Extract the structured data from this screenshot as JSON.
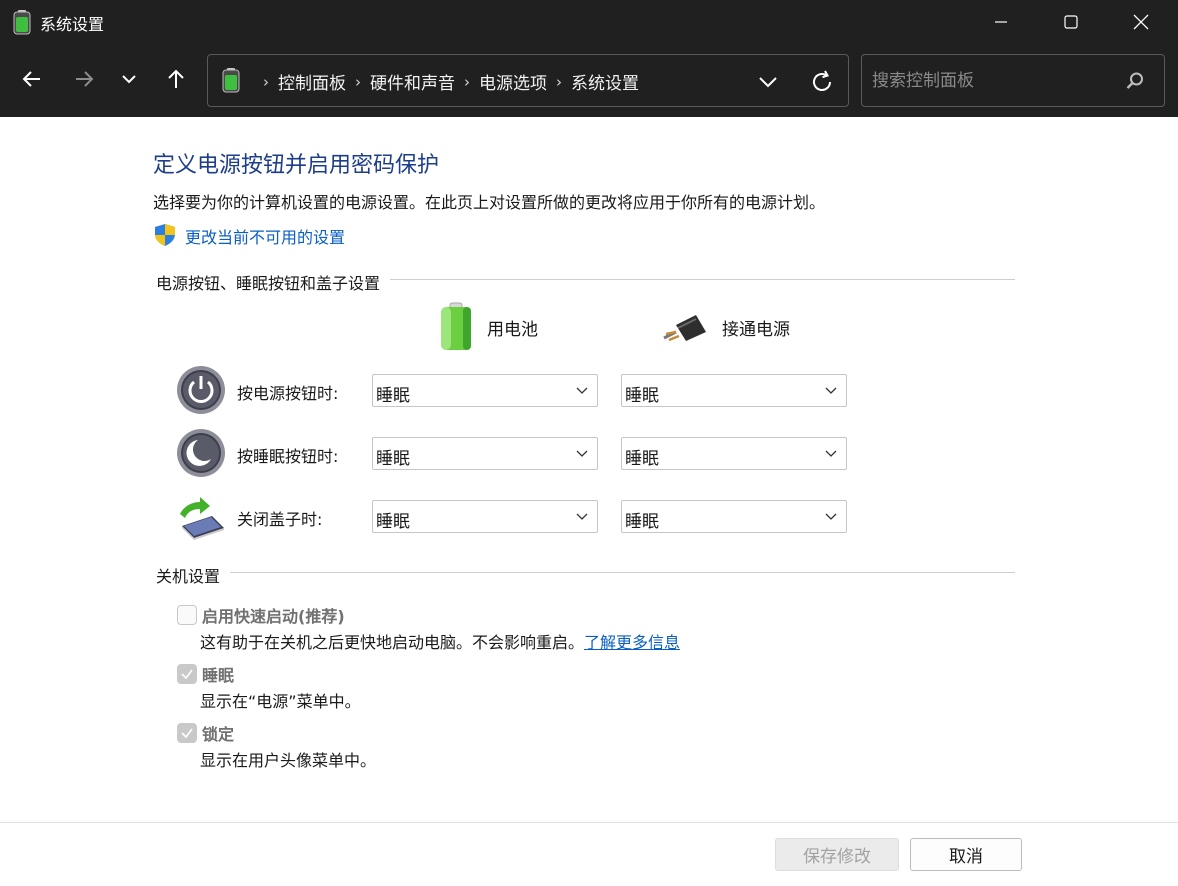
{
  "window": {
    "title": "系统设置",
    "icon": "battery-icon"
  },
  "nav": {
    "back_icon": "back-arrow-icon",
    "forward_icon": "forward-arrow-icon",
    "recent_icon": "chevron-down-icon",
    "up_icon": "up-arrow-icon",
    "breadcrumb": [
      "控制面板",
      "硬件和声音",
      "电源选项",
      "系统设置"
    ],
    "search_placeholder": "搜索控制面板"
  },
  "page": {
    "heading": "定义电源按钮并启用密码保护",
    "description": "选择要为你的计算机设置的电源设置。在此页上对设置所做的更改将应用于你所有的电源计划。",
    "change_settings_link": "更改当前不可用的设置"
  },
  "power_buttons": {
    "section_title": "电源按钮、睡眠按钮和盖子设置",
    "columns": {
      "battery": "用电池",
      "plugged_in": "接通电源"
    },
    "rows": [
      {
        "label": "按电源按钮时:",
        "icon": "power-button-icon",
        "battery": "睡眠",
        "plugged_in": "睡眠"
      },
      {
        "label": "按睡眠按钮时:",
        "icon": "sleep-button-icon",
        "battery": "睡眠",
        "plugged_in": "睡眠"
      },
      {
        "label": "关闭盖子时:",
        "icon": "laptop-lid-icon",
        "battery": "睡眠",
        "plugged_in": "睡眠"
      }
    ]
  },
  "shutdown": {
    "section_title": "关机设置",
    "items": [
      {
        "label": "启用快速启动(推荐)",
        "description": "这有助于在关机之后更快地启动电脑。不会影响重启。",
        "link": "了解更多信息",
        "checked": false
      },
      {
        "label": "睡眠",
        "description": "显示在“电源”菜单中。",
        "checked": true
      },
      {
        "label": "锁定",
        "description": "显示在用户头像菜单中。",
        "checked": true
      }
    ]
  },
  "footer": {
    "save_label": "保存修改",
    "cancel_label": "取消"
  },
  "colors": {
    "chrome": "#202020",
    "heading": "#1e3e8a",
    "link": "#0a5fc4",
    "battery_green": "#3fbf3f"
  }
}
